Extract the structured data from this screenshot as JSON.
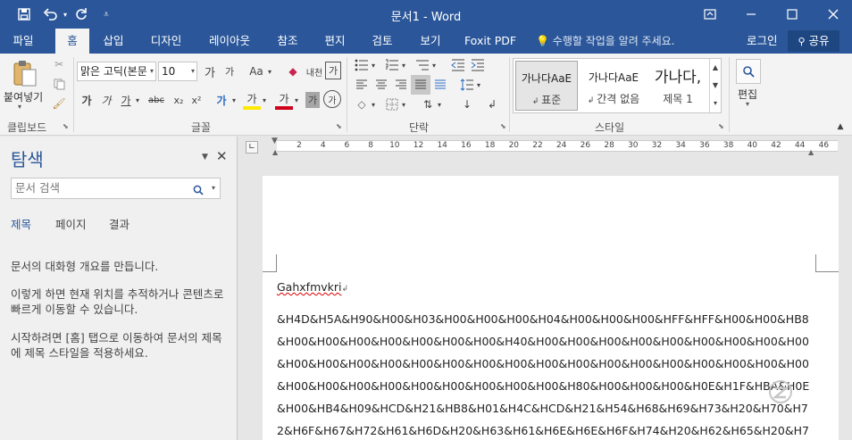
{
  "window": {
    "title": "문서1 - Word",
    "colors": {
      "title_bar": "#2b579a",
      "accent": "#2b579a"
    }
  },
  "quick_access": [
    "save-icon",
    "undo-icon",
    "redo-icon",
    "customize-icon"
  ],
  "tabs": [
    {
      "label": "파일"
    },
    {
      "label": "홈"
    },
    {
      "label": "삽입"
    },
    {
      "label": "디자인"
    },
    {
      "label": "레이아웃"
    },
    {
      "label": "참조"
    },
    {
      "label": "편지"
    },
    {
      "label": "검토"
    },
    {
      "label": "보기"
    },
    {
      "label": "Foxit PDF"
    }
  ],
  "tell_me": "수행할 작업을 알려 주세요.",
  "sign_in": "로그인",
  "share": "공유",
  "ribbon": {
    "clipboard": {
      "label": "클립보드",
      "paste": "붙여넣기"
    },
    "font": {
      "label": "글꼴",
      "font_name": "맑은 고딕(본문",
      "font_size": "10",
      "grow": "가",
      "shrink": "가",
      "change_case": "Aa",
      "phonetic": "내천",
      "enclose": "가",
      "bold": "가",
      "italic": "가",
      "underline": "가",
      "strike": "abc",
      "subscript": "x₂",
      "superscript": "x²",
      "text_effect": "가",
      "highlight": "가",
      "font_color": "가",
      "char_shading": "가",
      "enclosed_char": "가"
    },
    "paragraph": {
      "label": "단락"
    },
    "styles": {
      "label": "스타일",
      "items": [
        {
          "sample": "가나다AaE",
          "name": "표준"
        },
        {
          "sample": "가나다AaE",
          "name": "간격 없음"
        },
        {
          "sample": "가나다,",
          "name": "제목 1"
        }
      ]
    },
    "editing": {
      "label": "편집"
    }
  },
  "nav_pane": {
    "title": "탐색",
    "search_placeholder": "문서 검색",
    "tabs": [
      {
        "label": "제목"
      },
      {
        "label": "페이지"
      },
      {
        "label": "결과"
      }
    ],
    "paragraphs": [
      "문서의 대화형 개요를 만듭니다.",
      "이렇게 하면 현재 위치를 추적하거나 콘텐츠로 빠르게 이동할 수 있습니다.",
      "시작하려면 [홈] 탭으로 이동하여 문서의 제목에 제목 스타일을 적용하세요."
    ]
  },
  "ruler": {
    "marks": [
      "2",
      "4",
      "6",
      "8",
      "10",
      "12",
      "14",
      "16",
      "18",
      "20",
      "22",
      "24",
      "26",
      "28",
      "30",
      "32",
      "34",
      "36",
      "38",
      "40",
      "42",
      "44",
      "46"
    ]
  },
  "document": {
    "title_line": "Gahxfmvkri",
    "lines": [
      "&H4D&H5A&H90&H00&H03&H00&H00&H00&H04&H00&H00&H00&HFF&HFF&H00&H00&HB8",
      "&H00&H00&H00&H00&H00&H00&H00&H40&H00&H00&H00&H00&H00&H00&H00&H00&H00",
      "&H00&H00&H00&H00&H00&H00&H00&H00&H00&H00&H00&H00&H00&H00&H00&H00&H00",
      "&H00&H00&H00&H00&H00&H00&H00&H00&H00&H80&H00&H00&H00&H0E&H1F&HBA&H0E",
      "&H00&HB4&H09&HCD&H21&HB8&H01&H4C&HCD&H21&H54&H68&H69&H73&H20&H70&H7",
      "2&H6F&H67&H72&H61&H6D&H20&H63&H61&H6E&H6E&H6F&H74&H20&H62&H65&H20&H7"
    ]
  }
}
